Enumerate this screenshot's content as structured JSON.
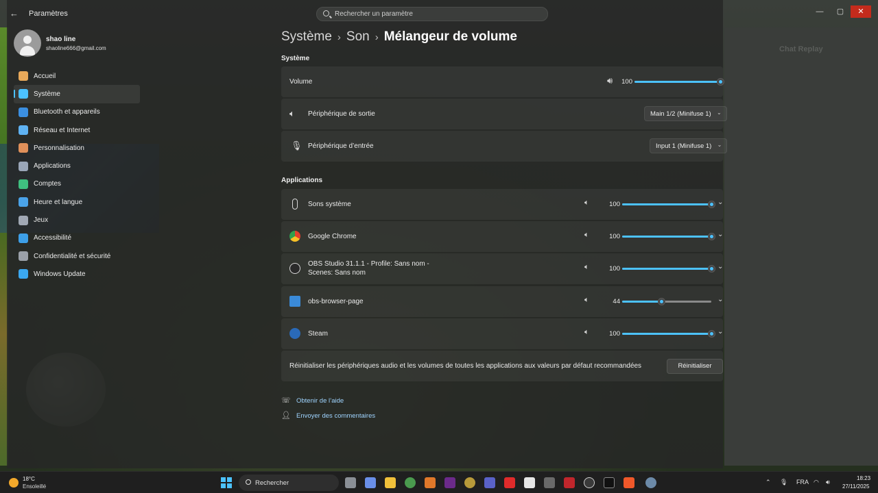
{
  "window": {
    "app_title": "Paramètres",
    "search_placeholder": "Rechercher un paramètre",
    "controls": {
      "minimize": "—",
      "maximize": "▢",
      "close": "✕"
    }
  },
  "profile": {
    "name": "shao line",
    "email": "shaoline666@gmail.com"
  },
  "sidebar": {
    "items": [
      {
        "label": "Accueil",
        "icon": "home-icon",
        "color": "#e8a95a",
        "active": false
      },
      {
        "label": "Système",
        "icon": "system-icon",
        "color": "#4cc2ff",
        "active": true
      },
      {
        "label": "Bluetooth et appareils",
        "icon": "bluetooth-icon",
        "color": "#3b8fe0",
        "active": false
      },
      {
        "label": "Réseau et Internet",
        "icon": "wifi-icon",
        "color": "#5fb2f2",
        "active": false
      },
      {
        "label": "Personnalisation",
        "icon": "brush-icon",
        "color": "#e0905a",
        "active": false
      },
      {
        "label": "Applications",
        "icon": "apps-icon",
        "color": "#9aa6b8",
        "active": false
      },
      {
        "label": "Comptes",
        "icon": "accounts-icon",
        "color": "#3fbf7f",
        "active": false
      },
      {
        "label": "Heure et langue",
        "icon": "globe-clock-icon",
        "color": "#4aa3e8",
        "active": false
      },
      {
        "label": "Jeux",
        "icon": "gamepad-icon",
        "color": "#a0a8b4",
        "active": false
      },
      {
        "label": "Accessibilité",
        "icon": "accessibility-icon",
        "color": "#3d9fe8",
        "active": false
      },
      {
        "label": "Confidentialité et sécurité",
        "icon": "shield-icon",
        "color": "#9aa0a8",
        "active": false
      },
      {
        "label": "Windows Update",
        "icon": "update-icon",
        "color": "#3ba8f0",
        "active": false
      }
    ]
  },
  "breadcrumb": {
    "items": [
      "Système",
      "Son"
    ],
    "current": "Mélangeur de volume"
  },
  "systeme_section": {
    "label": "Système",
    "volume": {
      "label": "Volume",
      "value": "100",
      "percent": 100
    },
    "output": {
      "label": "Périphérique de sortie",
      "selected": "Main 1/2 (Minifuse 1)"
    },
    "input": {
      "label": "Périphérique d’entrée",
      "selected": "Input 1 (Minifuse 1)"
    }
  },
  "applications_section": {
    "label": "Applications",
    "apps": [
      {
        "label": "Sons système",
        "value": "100",
        "percent": 100,
        "icon": "system-sounds-icon"
      },
      {
        "label": "Google Chrome",
        "value": "100",
        "percent": 100,
        "icon": "chrome-icon"
      },
      {
        "label": "OBS Studio 31.1.1 - Profile: Sans nom -",
        "label2": "Scenes: Sans nom",
        "value": "100",
        "percent": 100,
        "icon": "obs-icon"
      },
      {
        "label": "obs-browser-page",
        "value": "44",
        "percent": 44,
        "icon": "browser-page-icon"
      },
      {
        "label": "Steam",
        "value": "100",
        "percent": 100,
        "icon": "steam-icon"
      }
    ]
  },
  "reset": {
    "text": "Réinitialiser les périphériques audio et les volumes de toutes les applications aux valeurs par défaut recommandées",
    "button": "Réinitialiser"
  },
  "links": {
    "help": "Obtenir de l’aide",
    "feedback": "Envoyer des commentaires"
  },
  "background": {
    "chat_title": "Chat Replay"
  },
  "taskbar": {
    "weather_temp": "18°C",
    "weather_desc": "Ensoleillé",
    "search": "Rechercher",
    "language": "FRA",
    "time": "18:23",
    "date": "27/11/2025"
  },
  "colors": {
    "accent": "#4cc2ff",
    "close_button": "#c42b1c"
  }
}
